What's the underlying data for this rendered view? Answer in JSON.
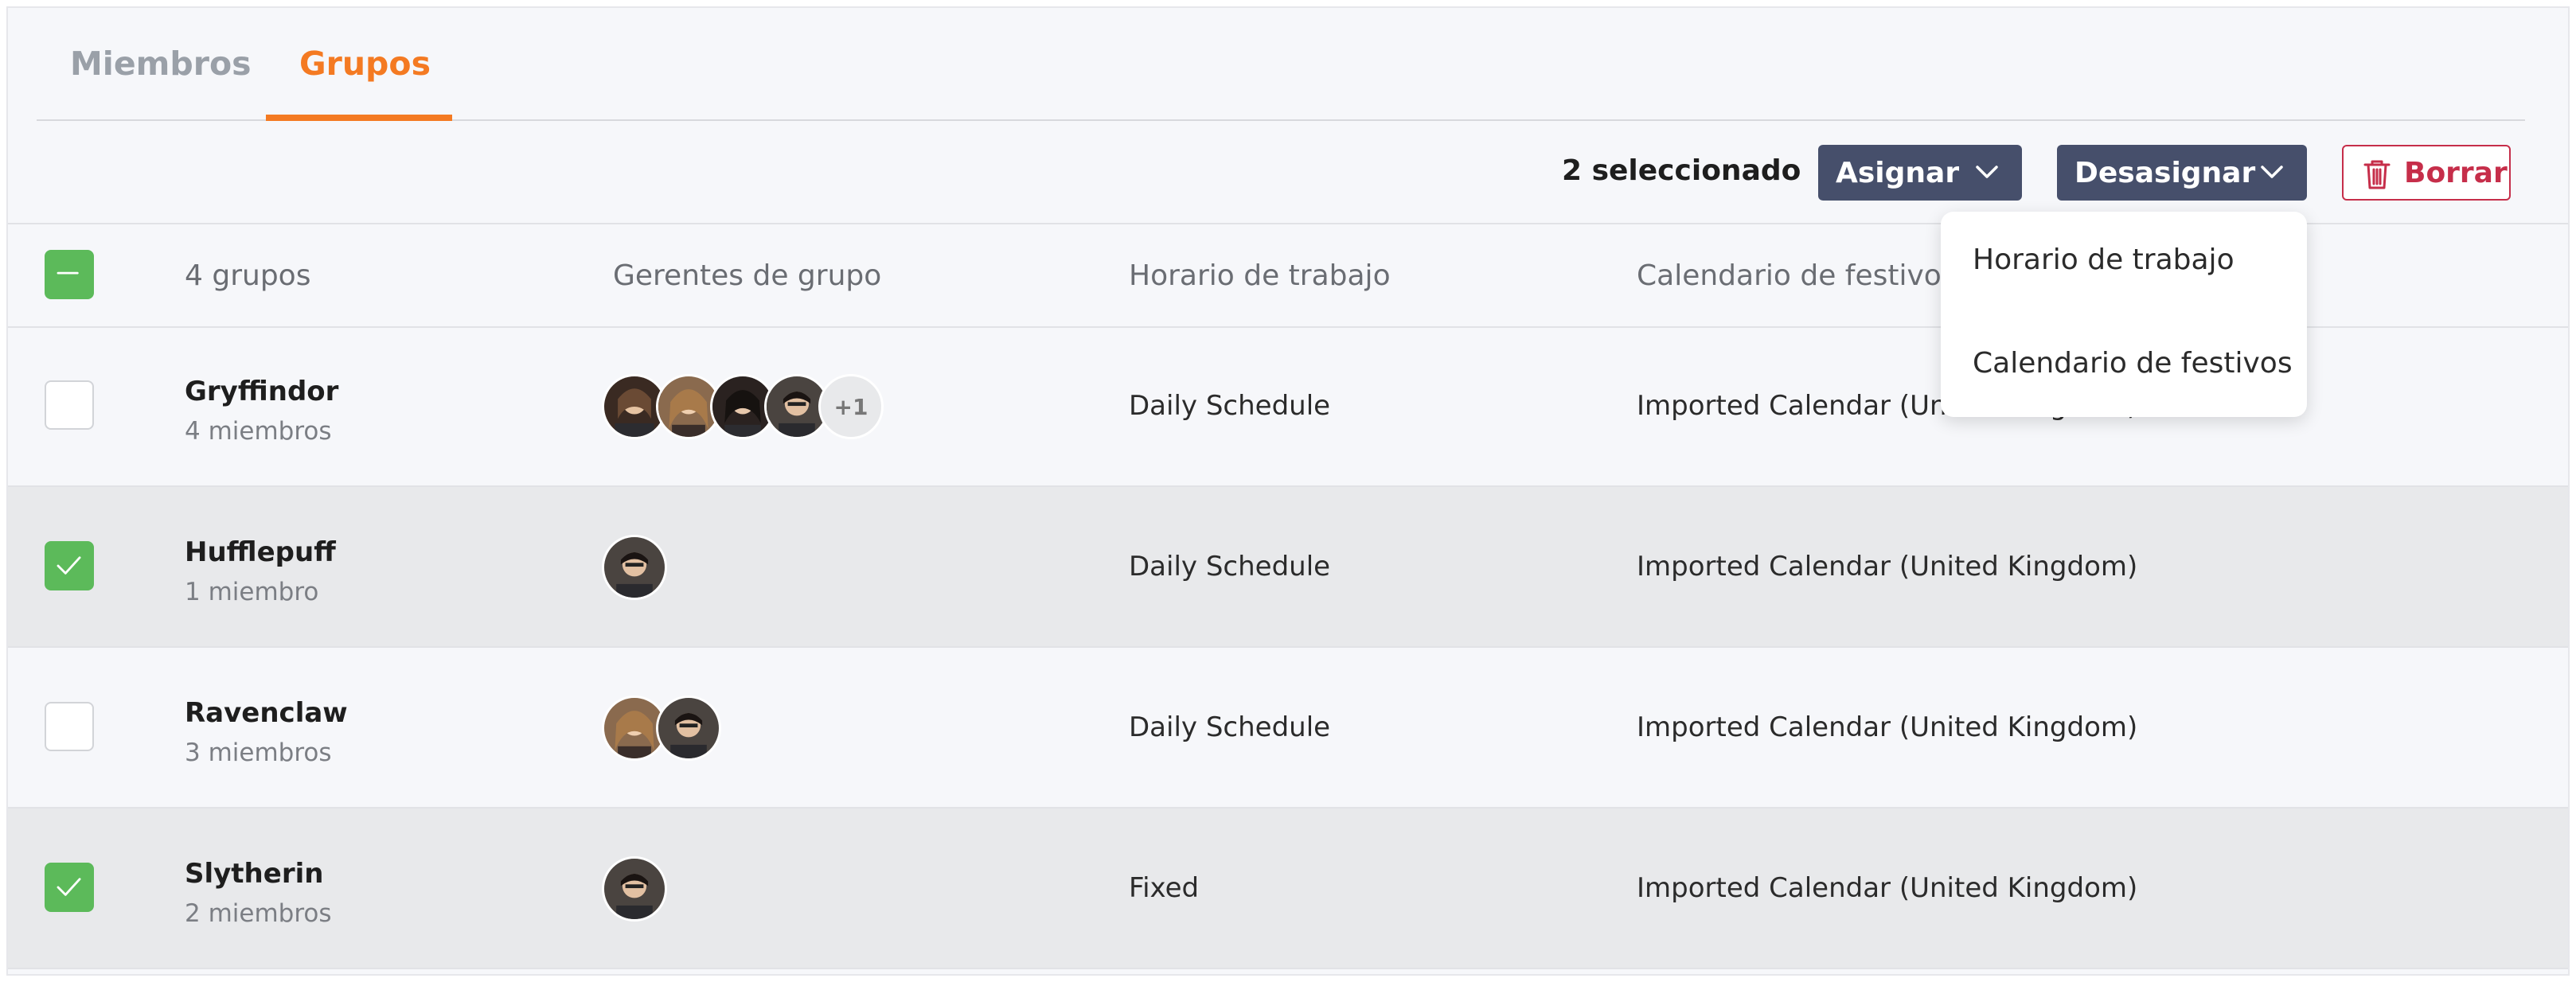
{
  "tabs": {
    "members": "Miembros",
    "groups": "Grupos",
    "active": "groups"
  },
  "toolbar": {
    "selected_count": "2 seleccionado",
    "assign_label": "Asignar",
    "unassign_label": "Desasignar",
    "delete_label": "Borrar"
  },
  "header": {
    "groups_count": "4 grupos",
    "managers": "Gerentes de grupo",
    "schedule": "Horario de trabajo",
    "holidays": "Calendario de festivos"
  },
  "dropdown": {
    "items": [
      "Horario de trabajo",
      "Calendario de festivos"
    ]
  },
  "rows": [
    {
      "name": "Gryffindor",
      "members": "4 miembros",
      "schedule": "Daily Schedule",
      "calendar": "Imported Calendar (United Kingdom)",
      "selected": false,
      "avatars": [
        "avatar-1",
        "avatar-2",
        "avatar-3",
        "avatar-4"
      ],
      "extra_avatars": "+1"
    },
    {
      "name": "Hufflepuff",
      "members": "1 miembro",
      "schedule": "Daily Schedule",
      "calendar": "Imported Calendar (United Kingdom)",
      "selected": true,
      "avatars": [
        "avatar-4"
      ]
    },
    {
      "name": "Ravenclaw",
      "members": "3 miembros",
      "schedule": "Daily Schedule",
      "calendar": "Imported Calendar (United Kingdom)",
      "selected": false,
      "avatars": [
        "avatar-2",
        "avatar-4"
      ]
    },
    {
      "name": "Slytherin",
      "members": "2 miembros",
      "schedule": "Fixed",
      "calendar": "Imported Calendar (United Kingdom)",
      "selected": true,
      "avatars": [
        "avatar-4"
      ]
    }
  ],
  "colors": {
    "accent": "#f47a22",
    "button_dark": "#464f6b",
    "delete": "#c62e4a",
    "checkbox_on": "#5cba5a",
    "row_selected_bg": "#e8e9eb"
  }
}
